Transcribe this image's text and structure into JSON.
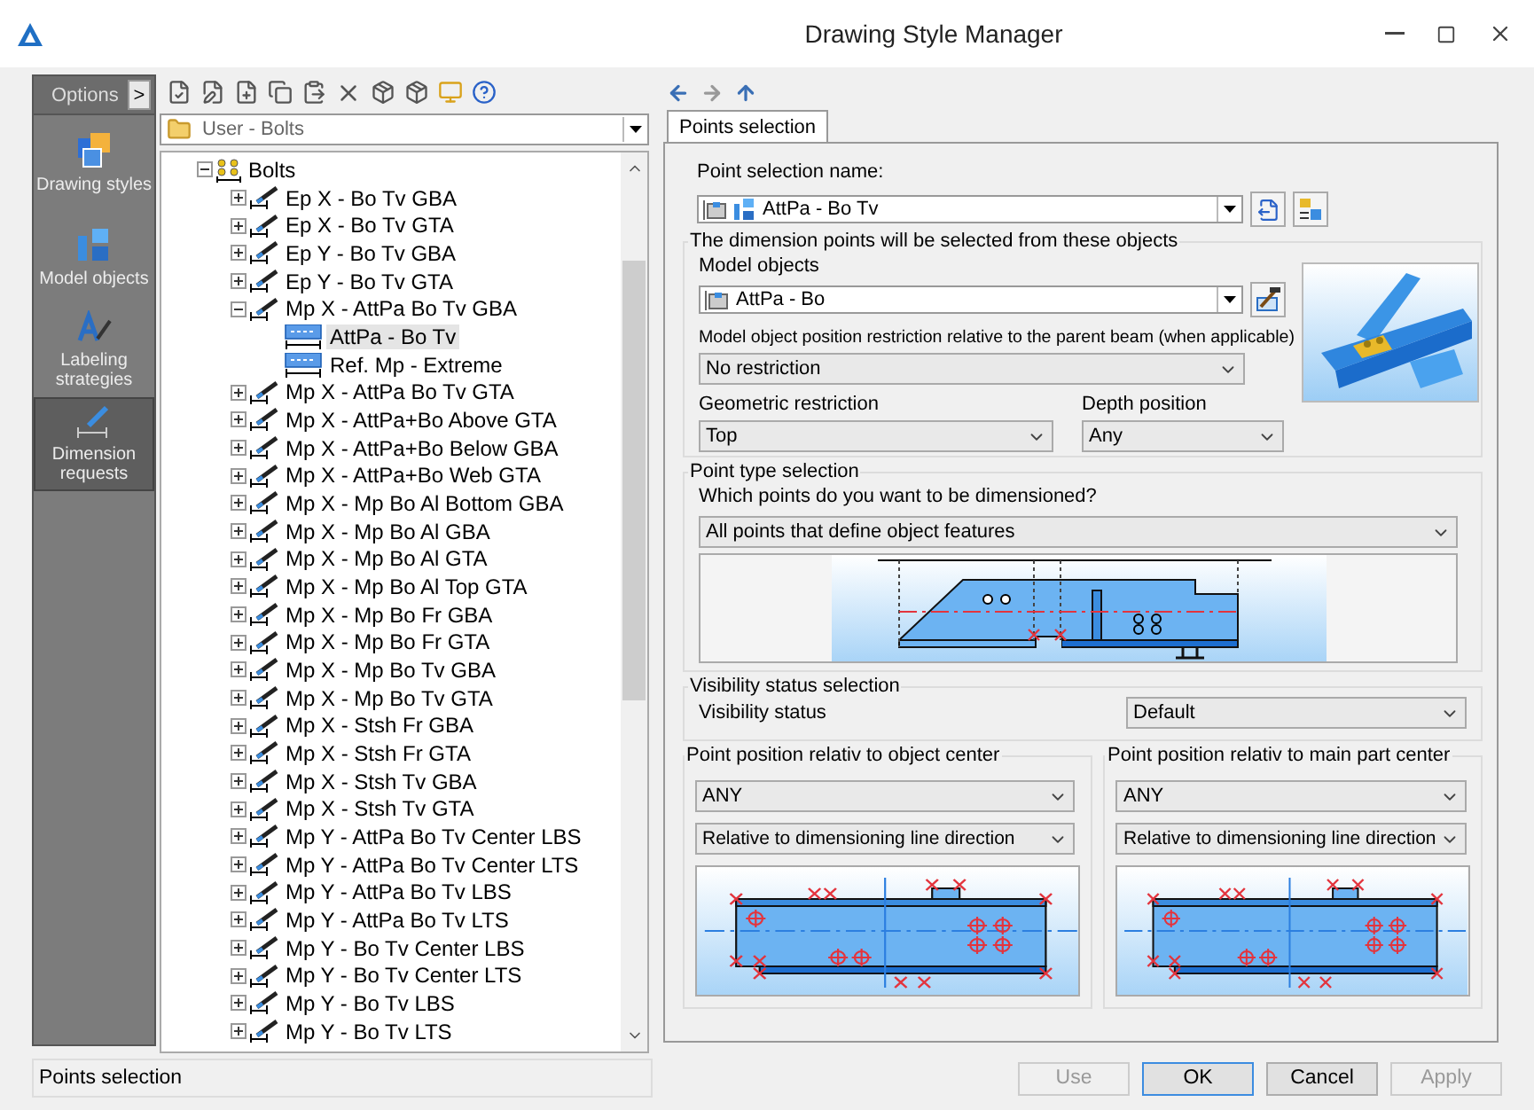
{
  "window": {
    "title": "Drawing Style Manager"
  },
  "sidebar": {
    "header": "Options",
    "expand_button": ">",
    "items": [
      {
        "label": "Drawing styles",
        "kind": "styles",
        "selected": false
      },
      {
        "label": "Model objects",
        "kind": "objects",
        "selected": false
      },
      {
        "label": "Labeling strategies",
        "kind": "labeling",
        "selected": false
      },
      {
        "label": "Dimension requests",
        "kind": "dimension",
        "selected": true
      }
    ]
  },
  "library": {
    "folder": "User - Bolts",
    "tree": [
      {
        "label": "Bolts",
        "kind": "group",
        "expanded": true,
        "selected": false,
        "children": [
          {
            "label": "Ep X - Bo Tv GBA",
            "kind": "request",
            "expanded": false,
            "selected": false
          },
          {
            "label": "Ep X - Bo Tv GTA",
            "kind": "request",
            "expanded": false,
            "selected": false
          },
          {
            "label": "Ep Y - Bo Tv GBA",
            "kind": "request",
            "expanded": false,
            "selected": false
          },
          {
            "label": "Ep Y - Bo Tv GTA",
            "kind": "request",
            "expanded": false,
            "selected": false
          },
          {
            "label": "Mp X - AttPa Bo Tv GBA",
            "kind": "request",
            "expanded": true,
            "selected": false,
            "children": [
              {
                "label": "AttPa - Bo Tv",
                "kind": "selection",
                "selected": true
              },
              {
                "label": "Ref. Mp - Extreme",
                "kind": "selection",
                "selected": false
              }
            ]
          },
          {
            "label": "Mp X - AttPa Bo Tv GTA",
            "kind": "request",
            "expanded": false,
            "selected": false
          },
          {
            "label": "Mp X - AttPa+Bo Above GTA",
            "kind": "request",
            "expanded": false,
            "selected": false
          },
          {
            "label": "Mp X - AttPa+Bo Below GBA",
            "kind": "request",
            "expanded": false,
            "selected": false
          },
          {
            "label": "Mp X - AttPa+Bo Web GTA",
            "kind": "request",
            "expanded": false,
            "selected": false
          },
          {
            "label": "Mp X - Mp Bo Al Bottom GBA",
            "kind": "request",
            "expanded": false,
            "selected": false
          },
          {
            "label": "Mp X - Mp Bo Al GBA",
            "kind": "request",
            "expanded": false,
            "selected": false
          },
          {
            "label": "Mp X - Mp Bo Al GTA",
            "kind": "request",
            "expanded": false,
            "selected": false
          },
          {
            "label": "Mp X - Mp Bo Al Top GTA",
            "kind": "request",
            "expanded": false,
            "selected": false
          },
          {
            "label": "Mp X - Mp Bo Fr GBA",
            "kind": "request",
            "expanded": false,
            "selected": false
          },
          {
            "label": "Mp X - Mp Bo Fr GTA",
            "kind": "request",
            "expanded": false,
            "selected": false
          },
          {
            "label": "Mp X - Mp Bo Tv GBA",
            "kind": "request",
            "expanded": false,
            "selected": false
          },
          {
            "label": "Mp X - Mp Bo Tv GTA",
            "kind": "request",
            "expanded": false,
            "selected": false
          },
          {
            "label": "Mp X - Stsh Fr GBA",
            "kind": "request",
            "expanded": false,
            "selected": false
          },
          {
            "label": "Mp X - Stsh Fr GTA",
            "kind": "request",
            "expanded": false,
            "selected": false
          },
          {
            "label": "Mp X - Stsh Tv GBA",
            "kind": "request",
            "expanded": false,
            "selected": false
          },
          {
            "label": "Mp X - Stsh Tv GTA",
            "kind": "request",
            "expanded": false,
            "selected": false
          },
          {
            "label": "Mp Y - AttPa Bo Tv Center LBS",
            "kind": "request",
            "expanded": false,
            "selected": false
          },
          {
            "label": "Mp Y - AttPa Bo Tv Center LTS",
            "kind": "request",
            "expanded": false,
            "selected": false
          },
          {
            "label": "Mp Y - AttPa Bo Tv LBS",
            "kind": "request",
            "expanded": false,
            "selected": false
          },
          {
            "label": "Mp Y - AttPa Bo Tv LTS",
            "kind": "request",
            "expanded": false,
            "selected": false
          },
          {
            "label": "Mp Y - Bo Tv Center LBS",
            "kind": "request",
            "expanded": false,
            "selected": false
          },
          {
            "label": "Mp Y - Bo Tv Center LTS",
            "kind": "request",
            "expanded": false,
            "selected": false
          },
          {
            "label": "Mp Y - Bo Tv LBS",
            "kind": "request",
            "expanded": false,
            "selected": false
          },
          {
            "label": "Mp Y - Bo Tv LTS",
            "kind": "request",
            "expanded": false,
            "selected": false
          }
        ]
      }
    ]
  },
  "tabs": [
    {
      "label": "Points selection",
      "selected": true
    }
  ],
  "points_selection": {
    "name_label": "Point selection name:",
    "name_value": "AttPa - Bo Tv",
    "objects_group": {
      "title": "The dimension points will be selected from these objects",
      "model_objects_label": "Model objects",
      "model_objects_value": "AttPa - Bo",
      "position_label": "Model object position restriction relative to the parent beam (when applicable)",
      "position_value": "No restriction",
      "geometric_label": "Geometric restriction",
      "geometric_value": "Top",
      "depth_label": "Depth position",
      "depth_value": "Any"
    },
    "point_type_group": {
      "title": "Point type selection",
      "question": "Which points do you want to be dimensioned?",
      "value": "All points that define object features"
    },
    "visibility_group": {
      "title": "Visibility status selection",
      "label": "Visibility status",
      "value": "Default"
    },
    "object_center_group": {
      "title": "Point position relativ to object center",
      "position": "ANY",
      "reference": "Relative to dimensioning line direction"
    },
    "main_part_group": {
      "title": "Point position relativ to main part center",
      "position": "ANY",
      "reference": "Relative to dimensioning line direction"
    }
  },
  "status_bar": "Points selection",
  "buttons": [
    {
      "label": "Use",
      "disabled": true,
      "default": false
    },
    {
      "label": "OK",
      "disabled": false,
      "default": true
    },
    {
      "label": "Cancel",
      "disabled": false,
      "default": false
    },
    {
      "label": "Apply",
      "disabled": true,
      "default": false
    }
  ]
}
